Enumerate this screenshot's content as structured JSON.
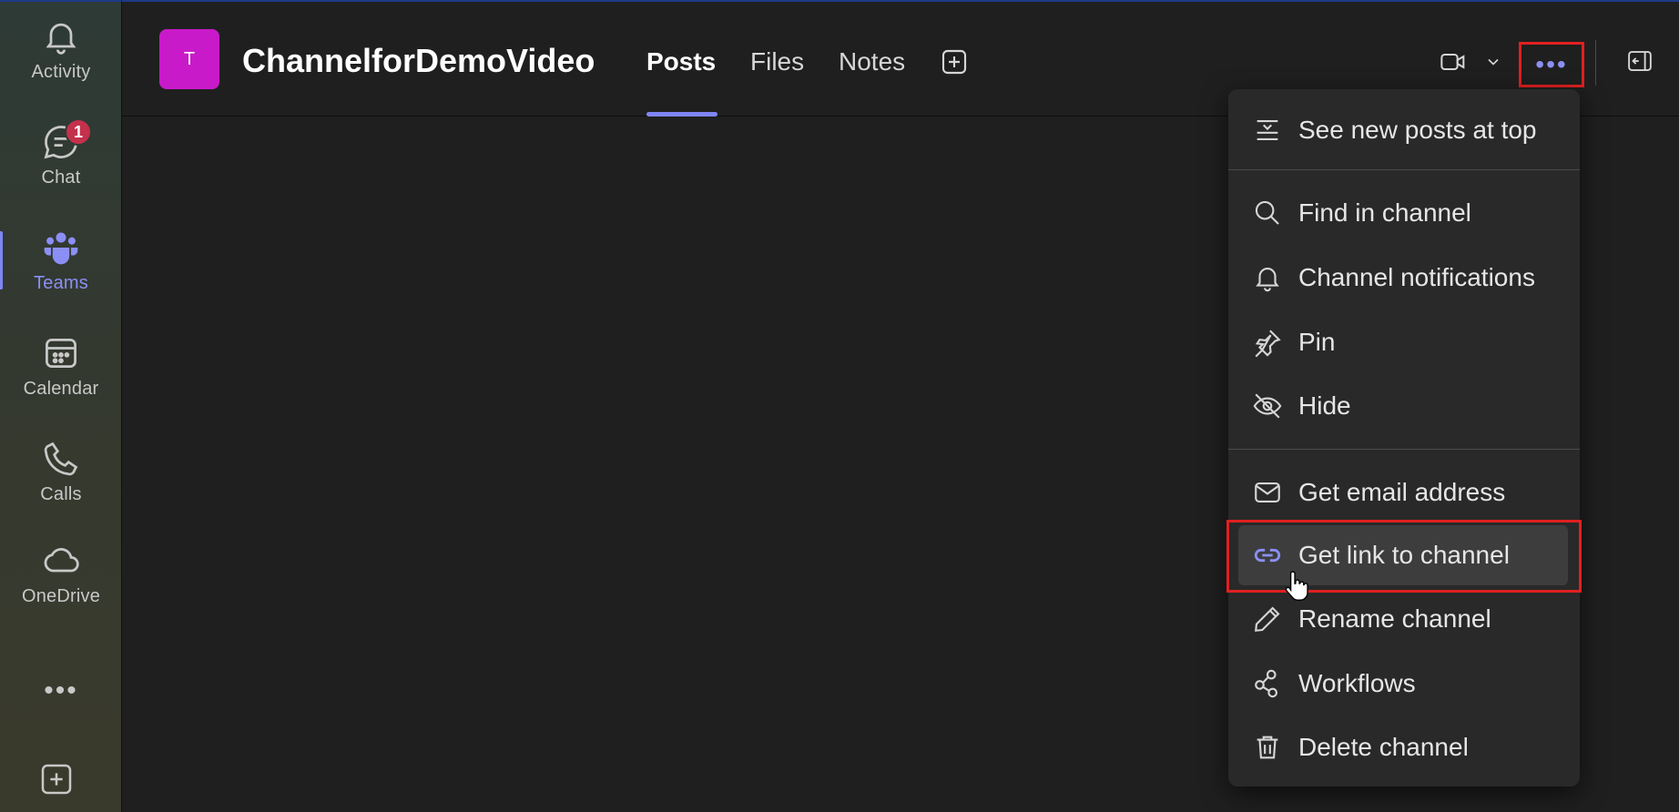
{
  "rail": {
    "items": [
      {
        "label": "Activity",
        "icon": "bell-icon"
      },
      {
        "label": "Chat",
        "icon": "chat-icon",
        "badge": "1"
      },
      {
        "label": "Teams",
        "icon": "teams-icon",
        "active": true
      },
      {
        "label": "Calendar",
        "icon": "calendar-icon"
      },
      {
        "label": "Calls",
        "icon": "phone-icon"
      },
      {
        "label": "OneDrive",
        "icon": "cloud-icon"
      }
    ],
    "more": "•••"
  },
  "header": {
    "team_avatar": "T",
    "channel_title": "ChannelforDemoVideo",
    "tabs": [
      {
        "label": "Posts",
        "active": true
      },
      {
        "label": "Files"
      },
      {
        "label": "Notes"
      }
    ],
    "more_button": "•••"
  },
  "menu": {
    "items": [
      {
        "label": "See new posts at top",
        "icon": "sort-lines-icon"
      },
      {
        "label": "Find in channel",
        "icon": "search-icon"
      },
      {
        "label": "Channel notifications",
        "icon": "bell-icon"
      },
      {
        "label": "Pin",
        "icon": "pin-icon"
      },
      {
        "label": "Hide",
        "icon": "eye-off-icon"
      },
      {
        "label": "Get email address",
        "icon": "mail-icon"
      },
      {
        "label": "Get link to channel",
        "icon": "link-icon",
        "highlighted": true
      },
      {
        "label": "Rename channel",
        "icon": "pencil-icon"
      },
      {
        "label": "Workflows",
        "icon": "workflows-icon"
      },
      {
        "label": "Delete channel",
        "icon": "trash-icon"
      }
    ]
  },
  "colors": {
    "accent": "#7f85f5",
    "team_avatar_bg": "#c91ac9",
    "highlight_box": "#e02020",
    "badge": "#c4314b"
  }
}
